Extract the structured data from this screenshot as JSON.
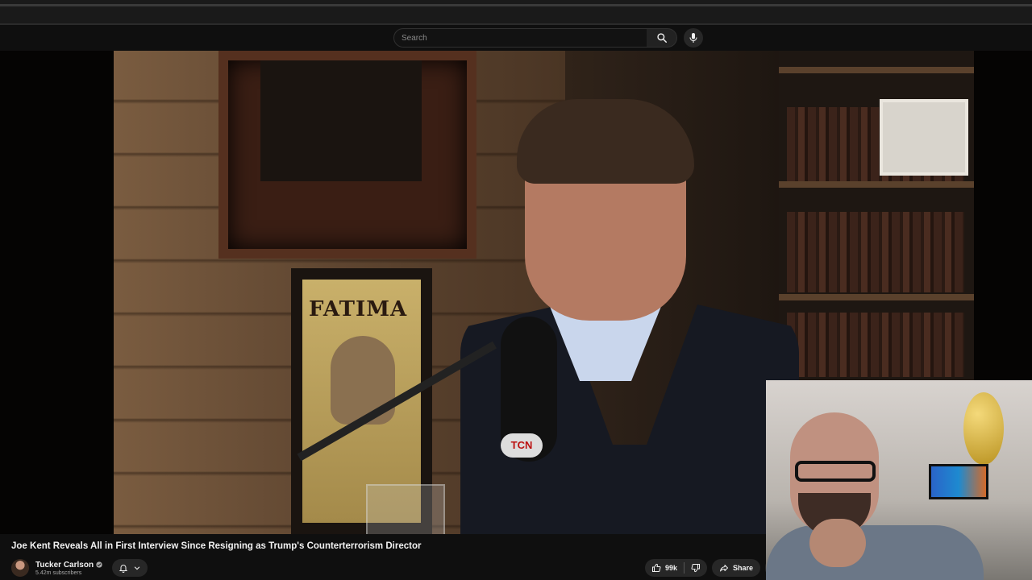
{
  "masthead": {
    "search": {
      "placeholder": "Search"
    },
    "icons": {
      "search": "search-icon",
      "mic": "microphone-icon"
    }
  },
  "video": {
    "title": "Joe Kent Reveals All in First Interview Since Resigning as Trump's Counterterrorism Director",
    "poster_text": "FATIMA",
    "mic_badge": "TCN"
  },
  "channel": {
    "name": "Tucker Carlson",
    "verified_icon": "verified-check-icon",
    "subscribers": "5.42m subscribers"
  },
  "actions": {
    "like_count": "99k",
    "share_label": "Share",
    "icons": {
      "like": "thumbs-up-icon",
      "dislike": "thumbs-down-icon",
      "share": "share-arrow-icon",
      "bell": "bell-icon",
      "chevron": "chevron-down-icon"
    }
  },
  "colors": {
    "background": "#0f0f0f",
    "text": "#f1f1f1",
    "secondary_text": "#aaaaaa",
    "button": "#272727"
  }
}
